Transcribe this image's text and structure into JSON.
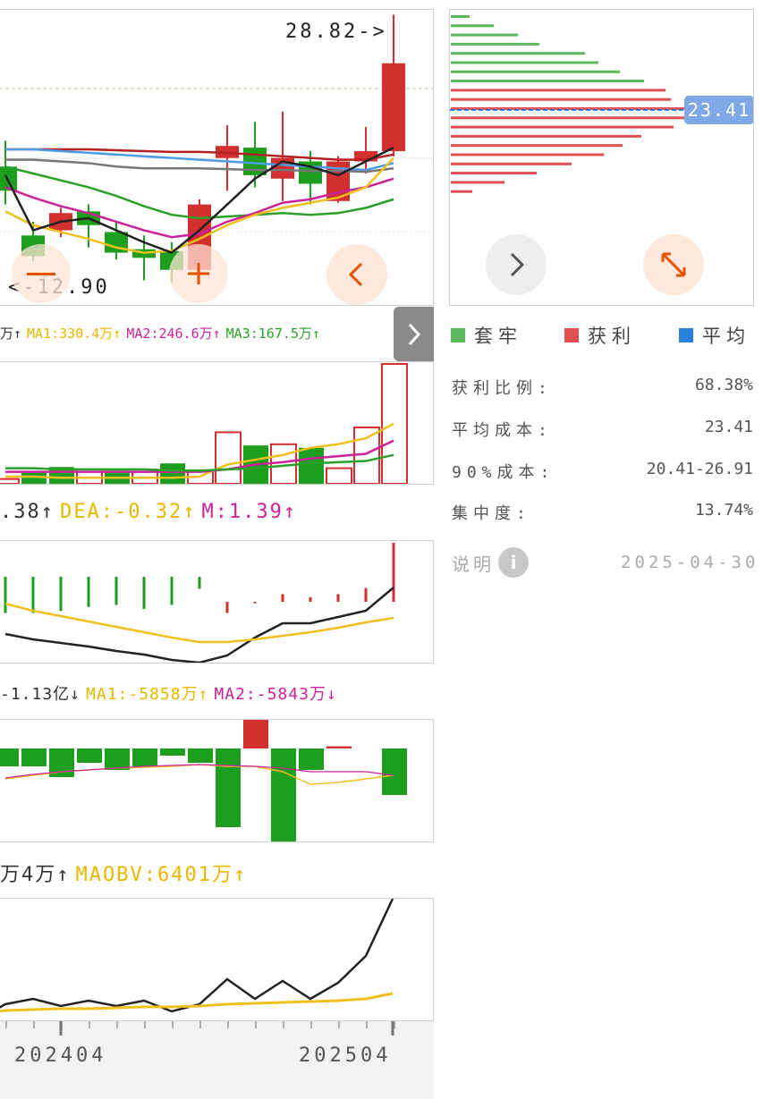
{
  "kline": {
    "high_label": "28.82->",
    "low_label": "<-12.90",
    "candles": [
      {
        "o": 20.0,
        "c": 18.6,
        "h": 21.5,
        "l": 17.8
      },
      {
        "o": 16.0,
        "c": 14.8,
        "h": 16.8,
        "l": 14.5
      },
      {
        "o": 16.3,
        "c": 17.3,
        "h": 17.6,
        "l": 15.9
      },
      {
        "o": 17.4,
        "c": 16.6,
        "h": 17.8,
        "l": 15.3
      },
      {
        "o": 16.2,
        "c": 15.0,
        "h": 16.8,
        "l": 14.6
      },
      {
        "o": 15.2,
        "c": 14.7,
        "h": 16.0,
        "l": 13.4
      },
      {
        "o": 15.1,
        "c": 14.0,
        "h": 15.6,
        "l": 13.3
      },
      {
        "o": 14.0,
        "c": 17.8,
        "h": 18.1,
        "l": 13.6
      },
      {
        "o": 20.5,
        "c": 21.2,
        "h": 22.4,
        "l": 18.6
      },
      {
        "o": 21.1,
        "c": 19.5,
        "h": 22.6,
        "l": 18.8
      },
      {
        "o": 19.3,
        "c": 20.5,
        "h": 23.2,
        "l": 18.0
      },
      {
        "o": 20.3,
        "c": 19.0,
        "h": 20.9,
        "l": 17.8
      },
      {
        "o": 18.0,
        "c": 20.3,
        "h": 20.6,
        "l": 17.9
      },
      {
        "o": 20.3,
        "c": 20.9,
        "h": 22.3,
        "l": 19.6
      },
      {
        "o": 20.9,
        "c": 26.0,
        "h": 28.82,
        "l": 20.6
      }
    ],
    "black_line": [
      19.5,
      16.3,
      16.8,
      17.0,
      16.3,
      15.6,
      15.0,
      16.3,
      17.8,
      19.3,
      20.3,
      20.0,
      19.5,
      20.3,
      21.1
    ],
    "ma_red": [
      21.0,
      21.0,
      21.0,
      21.0,
      20.95,
      20.9,
      20.85,
      20.85,
      20.8,
      20.7,
      20.6,
      20.5,
      20.4,
      20.4,
      20.7
    ],
    "ma_blue": [
      21.0,
      21.0,
      20.9,
      20.8,
      20.7,
      20.6,
      20.5,
      20.4,
      20.3,
      20.2,
      20.1,
      20.0,
      19.9,
      19.8,
      20.2
    ],
    "ma_gray": [
      20.4,
      20.4,
      20.3,
      20.2,
      20.0,
      19.9,
      19.9,
      19.9,
      19.85,
      19.8,
      19.8,
      19.75,
      19.75,
      19.7,
      19.9
    ],
    "ma_green": [
      20.0,
      19.6,
      19.2,
      18.8,
      18.3,
      17.7,
      17.2,
      17.0,
      17.1,
      17.2,
      17.3,
      17.2,
      17.3,
      17.6,
      18.1
    ],
    "ma_magenta": [
      18.8,
      18.2,
      17.7,
      17.3,
      16.8,
      16.3,
      15.9,
      16.1,
      16.8,
      17.3,
      17.9,
      18.1,
      18.5,
      18.8,
      19.3
    ],
    "ma_yellow": [
      17.4,
      16.6,
      16.2,
      15.8,
      15.3,
      15.0,
      15.1,
      15.8,
      16.6,
      17.2,
      17.6,
      17.9,
      18.2,
      18.8,
      20.5
    ]
  },
  "volume": {
    "legend": {
      "v": "万↑",
      "ma1": "MA1:330.4万↑",
      "ma2": "MA2:246.6万↑",
      "ma3": "MA3:167.5万↑"
    },
    "bars": [
      {
        "v": 0.04,
        "up": true
      },
      {
        "v": 0.1,
        "up": false
      },
      {
        "v": 0.14,
        "up": false
      },
      {
        "v": 0.12,
        "up": true
      },
      {
        "v": 0.11,
        "up": false
      },
      {
        "v": 0.1,
        "up": true
      },
      {
        "v": 0.17,
        "up": false
      },
      {
        "v": 0.1,
        "up": true
      },
      {
        "v": 0.43,
        "up": true
      },
      {
        "v": 0.32,
        "up": false
      },
      {
        "v": 0.33,
        "up": true
      },
      {
        "v": 0.3,
        "up": false
      },
      {
        "v": 0.13,
        "up": true
      },
      {
        "v": 0.47,
        "up": true
      },
      {
        "v": 1.0,
        "up": true
      }
    ]
  },
  "macd": {
    "legend": {
      "diff": ".38↑",
      "dea": "DEA:-0.32↑",
      "m": "M:1.39↑"
    },
    "hist": [
      -0.9,
      -0.9,
      -0.85,
      -0.75,
      -0.7,
      -0.8,
      -0.7,
      -0.3,
      0.14,
      0.3,
      0.45,
      0.4,
      0.45,
      0.55,
      1.0
    ]
  },
  "fund": {
    "legend": {
      "main": "-1.13亿↓",
      "ma1": "MA1:-5858万↑",
      "ma2": "MA2:-5843万↓"
    },
    "bars": [
      -0.25,
      -0.25,
      -0.4,
      -0.2,
      -0.3,
      -0.25,
      -0.1,
      -0.2,
      -1.1,
      0.42,
      -1.3,
      -0.3,
      0.03,
      -0.65
    ]
  },
  "obv": {
    "legend": {
      "obv": "万4万↑",
      "maobv": "MAOBV:6401万↑"
    }
  },
  "x_axis": {
    "left": "202404",
    "right": "202504"
  },
  "chip": {
    "price_tag": "23.41",
    "legend": {
      "loss": "套牢",
      "profit": "获利",
      "avg": "平均"
    },
    "rows": [
      {
        "label": "获利比例:",
        "value": "68.38%"
      },
      {
        "label": "平均成本:",
        "value": "23.41"
      },
      {
        "label": "90%成本:",
        "value": "20.41-26.91"
      },
      {
        "label": "集中度:",
        "value": "13.74%"
      }
    ],
    "note_label": "说明",
    "date": "2025-04-30",
    "bars": [
      {
        "w": 0.07,
        "g": true
      },
      {
        "w": 0.16,
        "g": true
      },
      {
        "w": 0.25,
        "g": true
      },
      {
        "w": 0.33,
        "g": true
      },
      {
        "w": 0.5,
        "g": true
      },
      {
        "w": 0.55,
        "g": true
      },
      {
        "w": 0.63,
        "g": true
      },
      {
        "w": 0.72,
        "g": true
      },
      {
        "w": 0.8,
        "g": false
      },
      {
        "w": 0.82,
        "g": false
      },
      {
        "w": 0.92,
        "g": false
      },
      {
        "w": 0.88,
        "g": false
      },
      {
        "w": 0.83,
        "g": false
      },
      {
        "w": 0.71,
        "g": false
      },
      {
        "w": 0.64,
        "g": false
      },
      {
        "w": 0.57,
        "g": false
      },
      {
        "w": 0.45,
        "g": false
      },
      {
        "w": 0.32,
        "g": false
      },
      {
        "w": 0.2,
        "g": false
      },
      {
        "w": 0.08,
        "g": false
      }
    ]
  },
  "colors": {
    "up": "#d32f2f",
    "down": "#1e9e1e",
    "yellow": "#f0c020",
    "magenta": "#cc2299",
    "green": "#2aa02a",
    "blue": "#2a7fdb",
    "accent": "#e65100"
  }
}
